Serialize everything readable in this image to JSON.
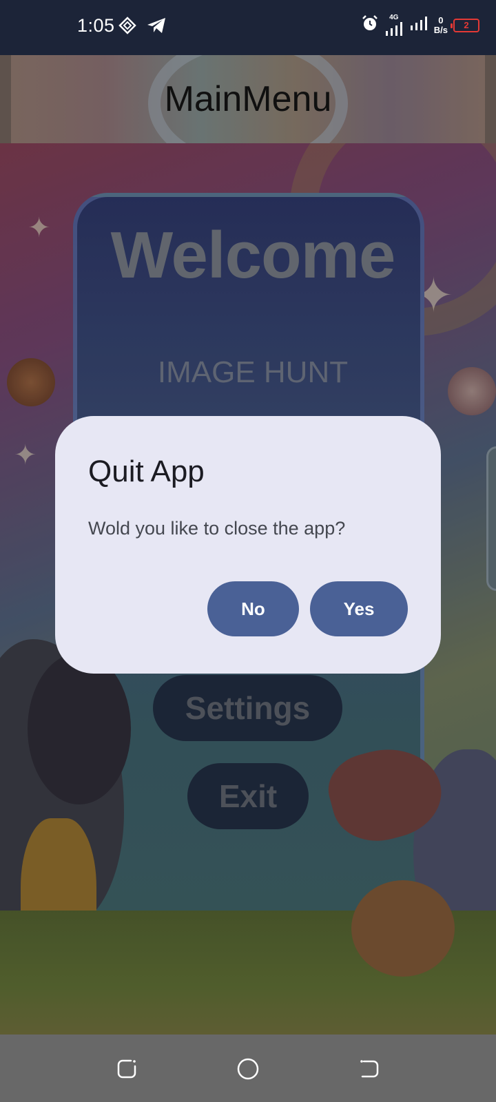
{
  "status_bar": {
    "time": "1:05",
    "network_type": "4G",
    "data_rate_value": "0",
    "data_rate_unit": "B/s",
    "battery_level": "2",
    "icons": [
      "location-diamond-icon",
      "telegram-icon",
      "alarm-icon",
      "signal-4g-icon",
      "signal-icon",
      "battery-icon"
    ]
  },
  "header": {
    "title": "MainMenu"
  },
  "background": {
    "welcome_text": "Welcome",
    "subtitle": "IMAGE HUNT",
    "menu": {
      "settings_label": "Settings",
      "exit_label": "Exit"
    }
  },
  "dialog": {
    "title": "Quit App",
    "message": "Wold you like to close the app?",
    "no_label": "No",
    "yes_label": "Yes",
    "button_color": "#4a6196",
    "background_color": "#e7e7f4"
  },
  "nav_bar": {
    "icons": [
      "recent-apps-icon",
      "home-icon",
      "back-icon"
    ]
  }
}
